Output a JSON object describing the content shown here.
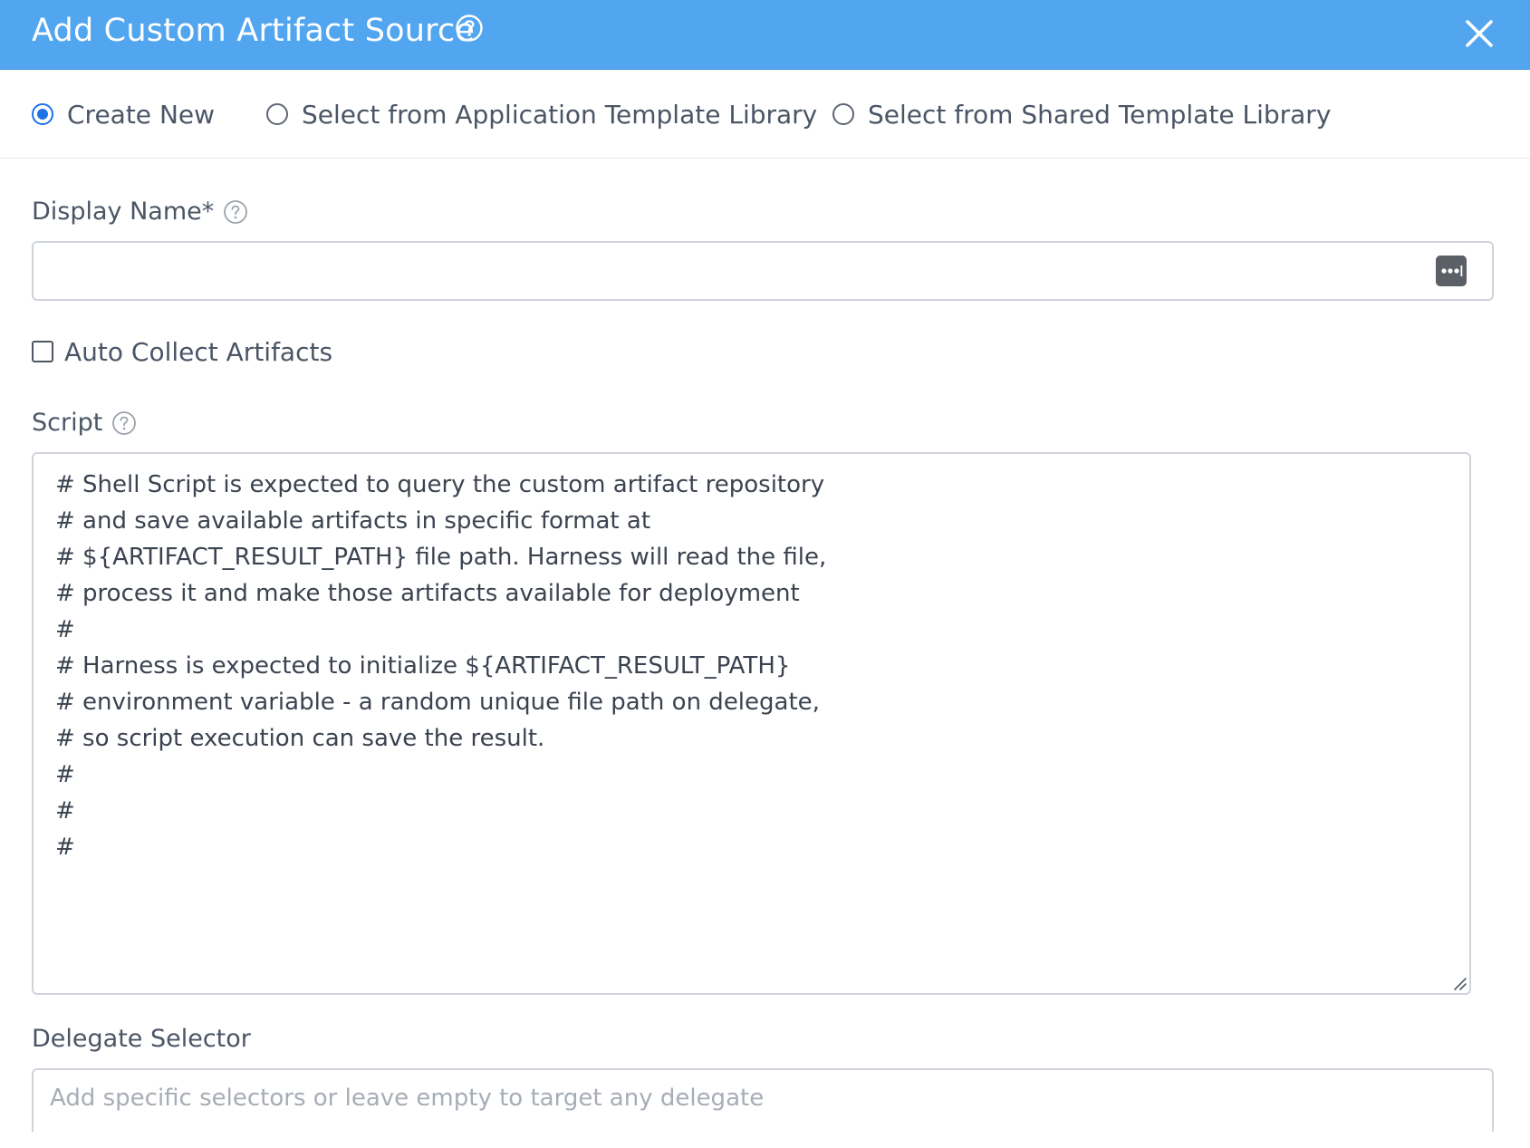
{
  "dialog": {
    "title": "Add Custom Artifact Source",
    "header_color": "#52a5ef",
    "help_icon": "help-circle-icon",
    "close_icon": "close-icon"
  },
  "source_options": [
    {
      "label": "Create New",
      "selected": true
    },
    {
      "label": "Select from Application Template Library",
      "selected": false
    },
    {
      "label": "Select from Shared Template Library",
      "selected": false
    }
  ],
  "display_name": {
    "label": "Display Name*",
    "value": "",
    "variable_button_icon": "ellipsis-icon"
  },
  "auto_collect": {
    "label": "Auto Collect Artifacts",
    "checked": false
  },
  "script": {
    "label": "Script",
    "lines": [
      "# Shell Script is expected to query the custom artifact repository",
      "# and save available artifacts in specific format at",
      "# ${ARTIFACT_RESULT_PATH} file path. Harness will read the file,",
      "# process it and make those artifacts available for deployment",
      "#",
      "# Harness is expected to initialize ${ARTIFACT_RESULT_PATH}",
      "# environment variable - a random unique file path on delegate,",
      "# so script execution can save the result.",
      "#",
      "#",
      "#"
    ]
  },
  "delegate_selector": {
    "label": "Delegate Selector",
    "placeholder": "Add specific selectors or leave empty to target any delegate"
  },
  "colors": {
    "accent": "#1e72e8",
    "text": "#4a5566",
    "border": "#cfd4db"
  }
}
